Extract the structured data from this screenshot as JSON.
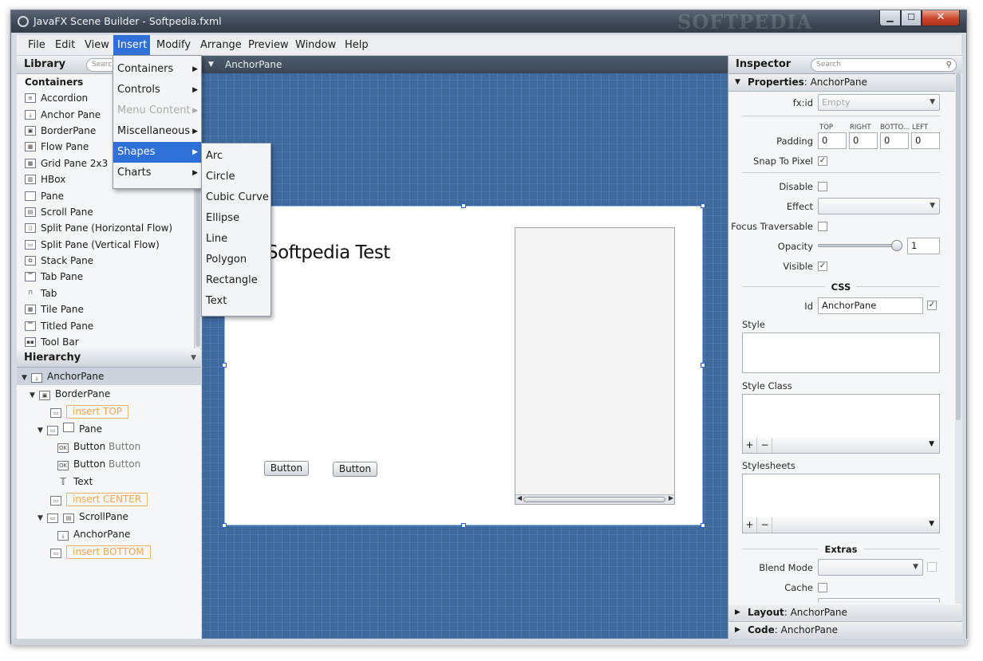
{
  "window": {
    "title": "JavaFX Scene Builder - Softpedia.fxml",
    "watermark": "SOFTPEDIA"
  },
  "menubar": [
    "File",
    "Edit",
    "View",
    "Insert",
    "Modify",
    "Arrange",
    "Preview",
    "Window",
    "Help"
  ],
  "library": {
    "title": "Library",
    "search_placeholder": "Search",
    "section": "Containers",
    "items": [
      "Accordion",
      "Anchor Pane",
      "BorderPane",
      "Flow Pane",
      "Grid Pane 2x3",
      "HBox",
      "Pane",
      "Scroll Pane",
      "Split Pane (Horizontal Flow)",
      "Split Pane (Vertical Flow)",
      "Stack Pane",
      "Tab Pane",
      "Tab",
      "Tile Pane",
      "Titled Pane",
      "Tool Bar"
    ]
  },
  "hierarchy": {
    "title": "Hierarchy",
    "rows": {
      "anchorpane": "AnchorPane",
      "borderpane": "BorderPane",
      "insert_top": "insert TOP",
      "pane": "Pane",
      "button1_type": "Button",
      "button1_text": "Button",
      "button2_type": "Button",
      "button2_text": "Button",
      "text": "Text",
      "insert_center": "insert CENTER",
      "scrollpane": "ScrollPane",
      "inner_anchor": "AnchorPane",
      "insert_bottom": "insert BOTTOM"
    }
  },
  "canvas": {
    "breadcrumb": "AnchorPane",
    "headline": "Softpedia Test",
    "button1": "Button",
    "button2": "Button"
  },
  "insert_menu": {
    "items": [
      "Containers",
      "Controls",
      "Menu Content",
      "Miscellaneous",
      "Shapes",
      "Charts"
    ],
    "highlighted": "Shapes",
    "disabled": "Menu Content"
  },
  "shapes_menu": [
    "Arc",
    "Circle",
    "Cubic Curve",
    "Ellipse",
    "Line",
    "Polygon",
    "Rectangle",
    "Text"
  ],
  "inspector": {
    "title": "Inspector",
    "search_placeholder": "Search",
    "properties_label": "Properties",
    "properties_target": ": AnchorPane",
    "fxid_label": "fx:id",
    "fxid_placeholder": "Empty",
    "padding_label": "Padding",
    "padding_headers": [
      "TOP",
      "RIGHT",
      "BOTTO...",
      "LEFT"
    ],
    "padding_values": [
      "0",
      "0",
      "0",
      "0"
    ],
    "snap_label": "Snap To Pixel",
    "disable_label": "Disable",
    "effect_label": "Effect",
    "focus_label": "Focus Traversable",
    "opacity_label": "Opacity",
    "opacity_value": "1",
    "visible_label": "Visible",
    "css_header": "CSS",
    "id_label": "Id",
    "id_value": "AnchorPane",
    "style_label": "Style",
    "style_class_label": "Style Class",
    "stylesheets_label": "Stylesheets",
    "extras_header": "Extras",
    "blend_label": "Blend Mode",
    "cache_label": "Cache",
    "layout_label": "Layout",
    "layout_target": ": AnchorPane",
    "code_label": "Code",
    "code_target": ": AnchorPane"
  }
}
